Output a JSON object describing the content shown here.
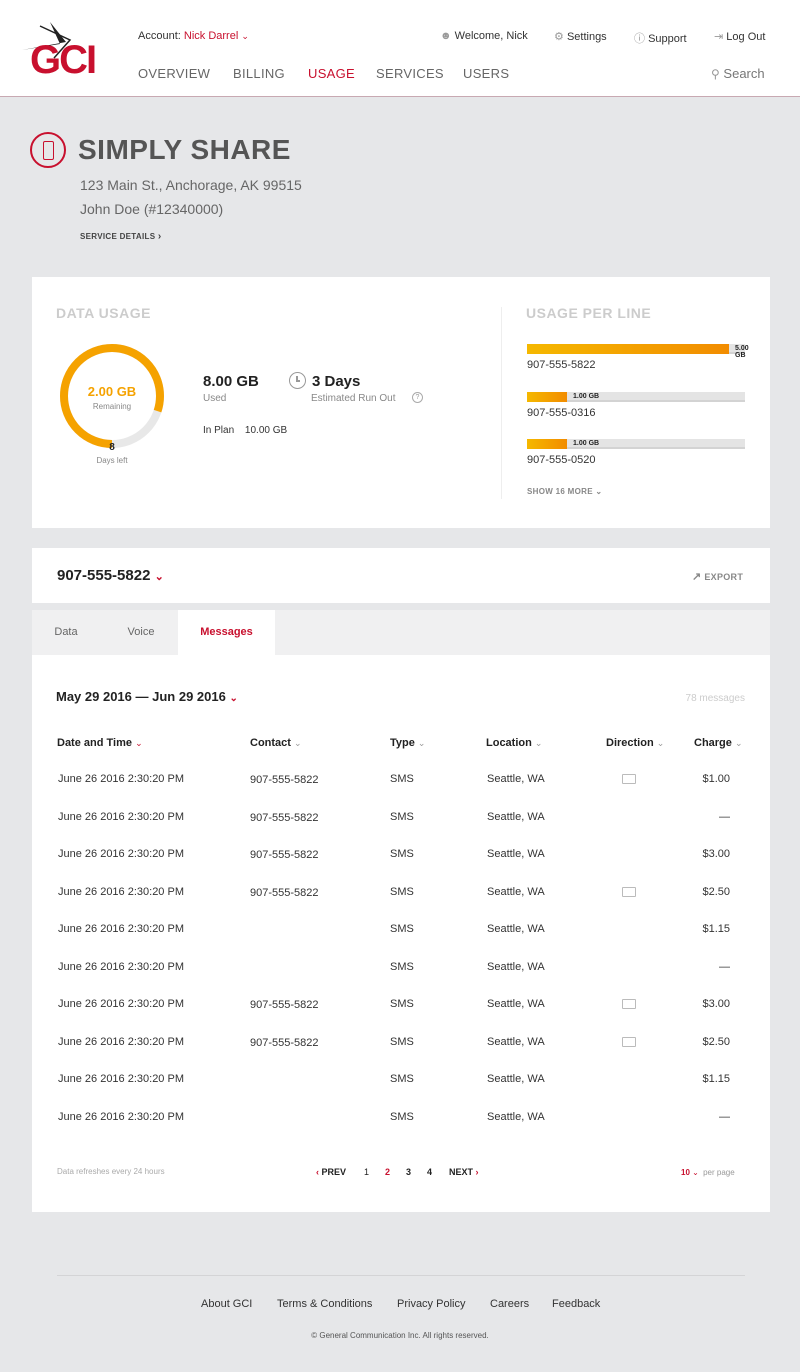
{
  "header": {
    "logo": "GCI",
    "account_label": "Account:",
    "account_name": "Nick Darrel",
    "welcome": "Welcome, Nick",
    "settings": "Settings",
    "support": "Support",
    "logout": "Log Out",
    "nav": [
      "OVERVIEW",
      "BILLING",
      "USAGE",
      "SERVICES",
      "USERS"
    ],
    "active_nav": "USAGE",
    "search": "Search"
  },
  "plan": {
    "title": "SIMPLY SHARE",
    "address": "123 Main St., Anchorage, AK 99515",
    "owner": "John Doe (#12340000)",
    "service_details": "SERVICE DETAILS"
  },
  "data_usage": {
    "label": "DATA USAGE",
    "remaining_value": "2.00 GB",
    "remaining_label": "Remaining",
    "remaining_fraction": 0.2,
    "days_left_value": "8",
    "days_left_label": "Days left",
    "used_value": "8.00 GB",
    "used_label": "Used",
    "runout_value": "3 Days",
    "runout_label": "Estimated Run Out",
    "in_plan_label": "In Plan",
    "in_plan_value": "10.00 GB"
  },
  "usage_per_line": {
    "label": "USAGE PER LINE",
    "lines": [
      {
        "number": "907-555-5822",
        "value": "5.00 GB",
        "gb": 5.0
      },
      {
        "number": "907-555-0316",
        "value": "1.00 GB",
        "gb": 1.0
      },
      {
        "number": "907-555-0520",
        "value": "1.00 GB",
        "gb": 1.0
      }
    ],
    "max_gb": 5.4,
    "show_more": "SHOW 16 MORE"
  },
  "line_selector": {
    "number": "907-555-5822",
    "export": "EXPORT"
  },
  "tabs": [
    "Data",
    "Voice",
    "Messages"
  ],
  "active_tab": "Messages",
  "messages": {
    "date_range": "May 29 2016 — Jun 29 2016",
    "count": "78 messages",
    "columns": [
      "Date and Time",
      "Contact",
      "Type",
      "Location",
      "Direction",
      "Charge"
    ],
    "rows": [
      {
        "date": "June 26 2016 2:30:20 PM",
        "contact": "907-555-5822",
        "type": "SMS",
        "location": "Seattle, WA",
        "direction": "outgoing",
        "charge": "$1.00"
      },
      {
        "date": "June 26 2016 2:30:20 PM",
        "contact": "907-555-5822",
        "type": "SMS",
        "location": "Seattle, WA",
        "direction": "",
        "charge": "—"
      },
      {
        "date": "June 26 2016 2:30:20 PM",
        "contact": "907-555-5822",
        "type": "SMS",
        "location": "Seattle, WA",
        "direction": "",
        "charge": "$3.00"
      },
      {
        "date": "June 26 2016 2:30:20 PM",
        "contact": "907-555-5822",
        "type": "SMS",
        "location": "Seattle, WA",
        "direction": "outgoing",
        "charge": "$2.50"
      },
      {
        "date": "June 26 2016 2:30:20 PM",
        "contact": "",
        "type": "SMS",
        "location": "Seattle, WA",
        "direction": "",
        "charge": "$1.15"
      },
      {
        "date": "June 26 2016 2:30:20 PM",
        "contact": "",
        "type": "SMS",
        "location": "Seattle, WA",
        "direction": "",
        "charge": "—"
      },
      {
        "date": "June 26 2016 2:30:20 PM",
        "contact": "907-555-5822",
        "type": "SMS",
        "location": "Seattle, WA",
        "direction": "outgoing",
        "charge": "$3.00"
      },
      {
        "date": "June 26 2016 2:30:20 PM",
        "contact": "907-555-5822",
        "type": "SMS",
        "location": "Seattle, WA",
        "direction": "outgoing",
        "charge": "$2.50"
      },
      {
        "date": "June 26 2016 2:30:20 PM",
        "contact": "",
        "type": "SMS",
        "location": "Seattle, WA",
        "direction": "",
        "charge": "$1.15"
      },
      {
        "date": "June 26 2016 2:30:20 PM",
        "contact": "",
        "type": "SMS",
        "location": "Seattle, WA",
        "direction": "",
        "charge": "—"
      }
    ],
    "refresh_note": "Data refreshes every 24 hours",
    "pagination": {
      "prev": "PREV",
      "pages": [
        "1",
        "2",
        "3",
        "4"
      ],
      "current": "2",
      "next": "NEXT"
    },
    "per_page_value": "10",
    "per_page_label": "per page"
  },
  "footer": {
    "links": [
      "About GCI",
      "Terms & Conditions",
      "Privacy Policy",
      "Careers",
      "Feedback"
    ],
    "copyright": "© General Communication Inc. All rights reserved."
  },
  "colors": {
    "brand": "#c8102e",
    "accent": "#f5a200",
    "background": "#e6e7e9"
  }
}
